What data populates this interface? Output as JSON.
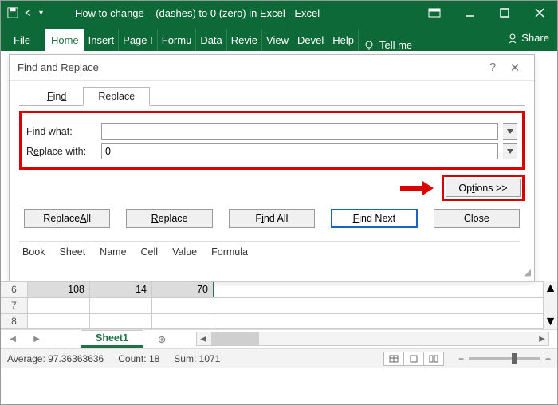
{
  "titlebar": {
    "title": "How to change – (dashes) to 0 (zero) in Excel  -  Excel"
  },
  "ribbon": {
    "tabs": [
      "File",
      "Home",
      "Insert",
      "Page I",
      "Formu",
      "Data",
      "Revie",
      "View",
      "Devel",
      "Help"
    ],
    "active_index": 1,
    "tellme": "Tell me",
    "share": "Share"
  },
  "dialog": {
    "title": "Find and Replace",
    "tabs": {
      "find": "Find",
      "replace": "Replace",
      "active": "replace"
    },
    "find_what_label": "Find what:",
    "replace_with_label": "Replace with:",
    "find_what_value": "-",
    "replace_with_value": "0",
    "options_btn": "Options >>",
    "buttons": {
      "replace_all": "Replace All",
      "replace": "Replace",
      "find_all": "Find All",
      "find_next": "Find Next",
      "close": "Close"
    },
    "headers": [
      "Book",
      "Sheet",
      "Name",
      "Cell",
      "Value",
      "Formula"
    ]
  },
  "sheet": {
    "row6": {
      "num": "6"
    },
    "row7": {
      "num": "7"
    },
    "row8": {
      "num": "8"
    },
    "cells6": [
      "108",
      "14",
      "70"
    ]
  },
  "tabsbar": {
    "sheet_name": "Sheet1"
  },
  "status": {
    "average_label": "Average:",
    "average_value": "97.36363636",
    "count_label": "Count:",
    "count_value": "18",
    "sum_label": "Sum:",
    "sum_value": "1071"
  }
}
